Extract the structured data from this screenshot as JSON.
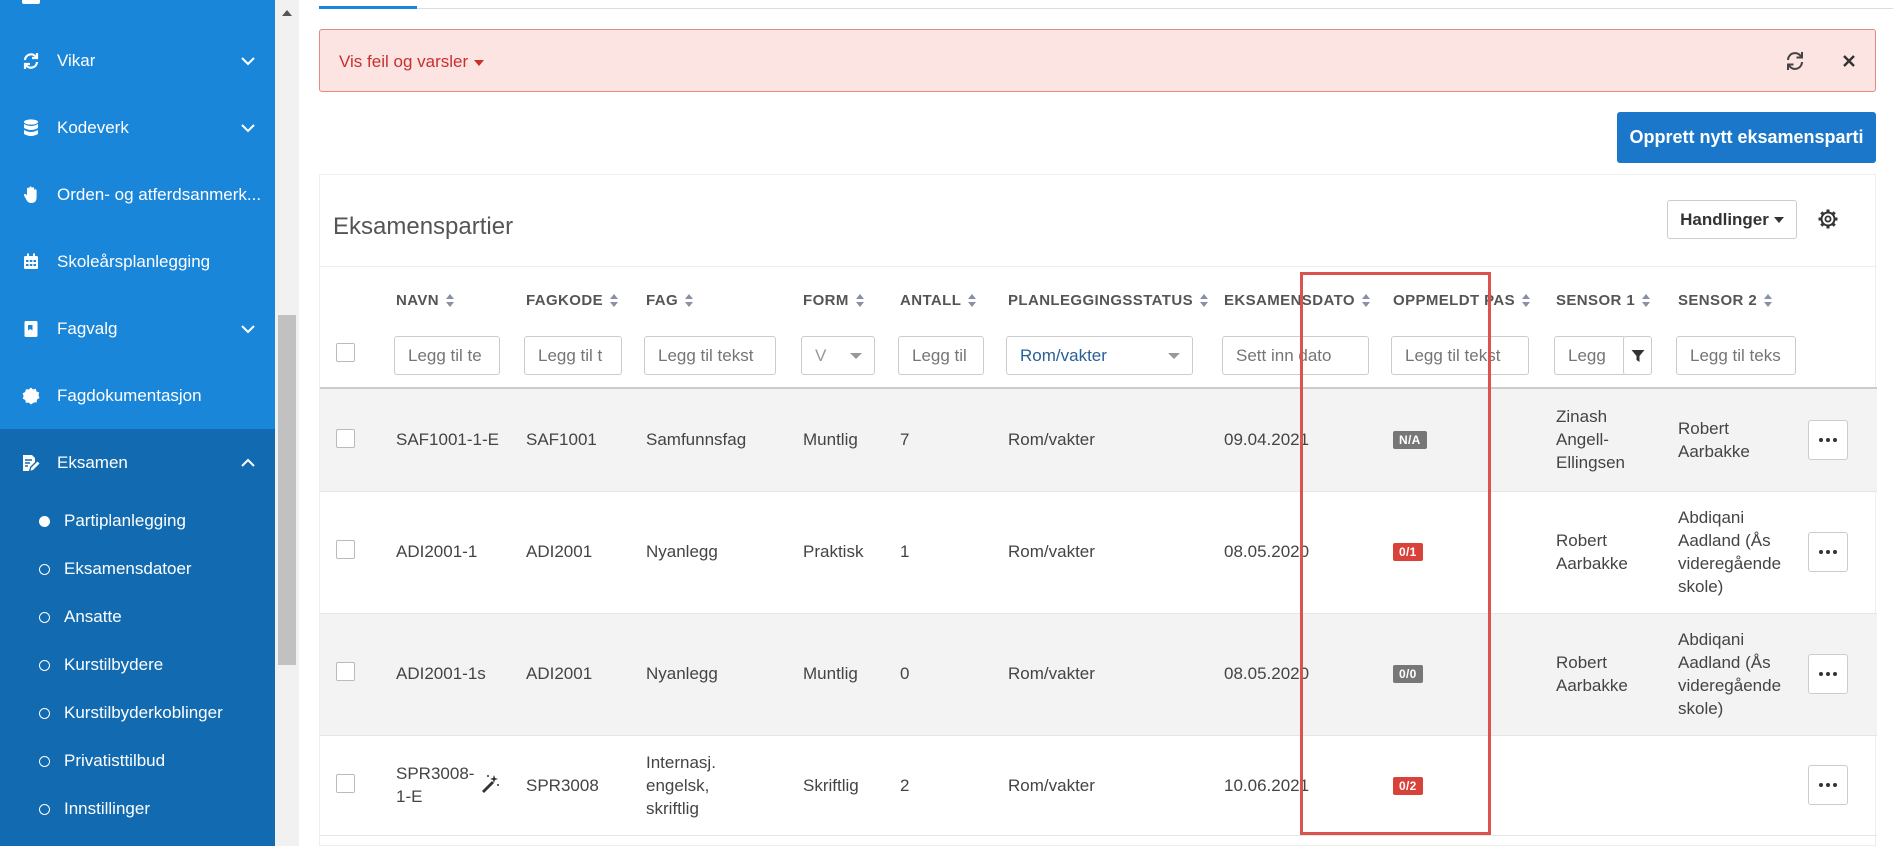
{
  "sidebar": {
    "items": [
      {
        "label": "Vikar",
        "icon": "refresh-icon",
        "expandable": true
      },
      {
        "label": "Kodeverk",
        "icon": "database-icon",
        "expandable": true
      },
      {
        "label": "Orden- og atferdsanmerk...",
        "icon": "hand-icon",
        "expandable": false
      },
      {
        "label": "Skoleårsplanlegging",
        "icon": "calendar-icon",
        "expandable": false
      },
      {
        "label": "Fagvalg",
        "icon": "book-icon",
        "expandable": true
      },
      {
        "label": "Fagdokumentasjon",
        "icon": "seal-icon",
        "expandable": false
      }
    ],
    "group": {
      "label": "Eksamen",
      "icon": "edit-document-icon",
      "expanded": true,
      "subitems": [
        {
          "label": "Partiplanlegging",
          "active": true
        },
        {
          "label": "Eksamensdatoer",
          "active": false
        },
        {
          "label": "Ansatte",
          "active": false
        },
        {
          "label": "Kurstilbydere",
          "active": false
        },
        {
          "label": "Kurstilbyderkoblinger",
          "active": false
        },
        {
          "label": "Privatisttilbud",
          "active": false
        },
        {
          "label": "Innstillinger",
          "active": false
        }
      ]
    }
  },
  "alert": {
    "label": "Vis feil og varsler"
  },
  "toolbar": {
    "create_label": "Opprett nytt eksamensparti"
  },
  "card": {
    "title": "Eksamenspartier",
    "actions_label": "Handlinger"
  },
  "table": {
    "columns": [
      {
        "key": "navn",
        "label": "NAVN",
        "filter_placeholder": "Legg til te"
      },
      {
        "key": "fagkode",
        "label": "FAGKODE",
        "filter_placeholder": "Legg til t"
      },
      {
        "key": "fag",
        "label": "FAG",
        "filter_placeholder": "Legg til tekst"
      },
      {
        "key": "form",
        "label": "FORM",
        "filter_value": "V"
      },
      {
        "key": "antall",
        "label": "ANTALL",
        "filter_placeholder": "Legg til"
      },
      {
        "key": "planleggingsstatus",
        "label": "PLANLEGGINGSSTATUS",
        "filter_value": "Rom/vakter"
      },
      {
        "key": "eksamensdato",
        "label": "EKSAMENSDATO",
        "filter_placeholder": "Sett inn dato"
      },
      {
        "key": "oppmeldt",
        "label": "OPPMELDT PAS",
        "filter_placeholder": "Legg til tekst"
      },
      {
        "key": "sensor1",
        "label": "SENSOR 1",
        "filter_placeholder": "Legg"
      },
      {
        "key": "sensor2",
        "label": "SENSOR 2",
        "filter_placeholder": "Legg til teks"
      }
    ],
    "rows": [
      {
        "navn": "SAF1001-1-E",
        "fagkode": "SAF1001",
        "fag": "Samfunnsfag",
        "form": "Muntlig",
        "antall": "7",
        "status": "Rom/vakter",
        "dato": "09.04.2021",
        "oppmeldt": "N/A",
        "oppmeldt_color": "#777777",
        "sensor1": "Zinash Angell-Ellingsen",
        "sensor2": "Robert Aarbakke"
      },
      {
        "navn": "ADI2001-1",
        "fagkode": "ADI2001",
        "fag": "Nyanlegg",
        "form": "Praktisk",
        "antall": "1",
        "status": "Rom/vakter",
        "dato": "08.05.2020",
        "oppmeldt": "0/1",
        "oppmeldt_color": "#d9423a",
        "sensor1": "Robert Aarbakke",
        "sensor2": "Abdiqani Aadland (Ås videregående skole)"
      },
      {
        "navn": "ADI2001-1s",
        "fagkode": "ADI2001",
        "fag": "Nyanlegg",
        "form": "Muntlig",
        "antall": "0",
        "status": "Rom/vakter",
        "dato": "08.05.2020",
        "oppmeldt": "0/0",
        "oppmeldt_color": "#777777",
        "sensor1": "Robert Aarbakke",
        "sensor2": "Abdiqani Aadland (Ås videregående skole)"
      },
      {
        "navn": "SPR3008-1-E",
        "fagkode": "SPR3008",
        "fag": "Internasj. engelsk, skriftlig",
        "form": "Skriftlig",
        "antall": "2",
        "status": "Rom/vakter",
        "dato": "10.06.2021",
        "oppmeldt": "0/2",
        "oppmeldt_color": "#d9423a",
        "sensor1": "",
        "sensor2": ""
      }
    ]
  },
  "colors": {
    "sidebar": "#1a86d9",
    "sidebar_group": "#126ab0",
    "primary_button": "#1a77c9",
    "alert_bg": "#fbe4e2",
    "alert_text": "#c9302c",
    "highlight": "#d9534f"
  }
}
